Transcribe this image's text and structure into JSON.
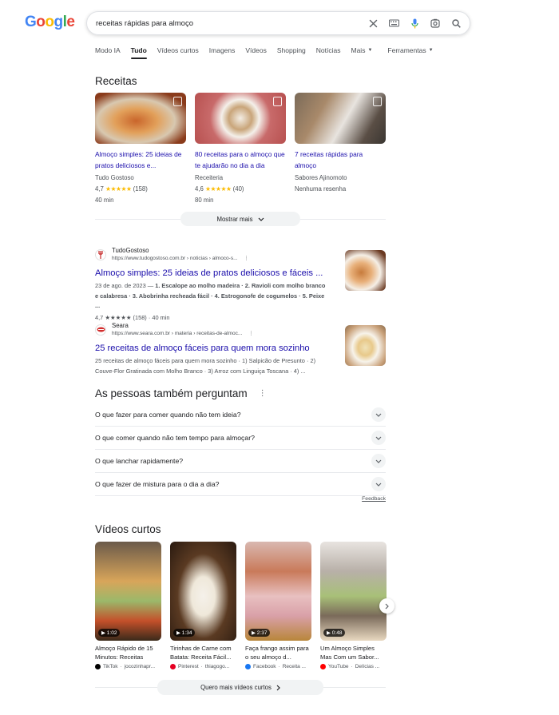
{
  "logo": {
    "letters": [
      "G",
      "o",
      "o",
      "g",
      "l",
      "e"
    ],
    "colors": [
      "#4285f4",
      "#ea4335",
      "#fbbc05",
      "#4285f4",
      "#34a853",
      "#ea4335"
    ]
  },
  "search": {
    "query": "receitas rápidas para almoço"
  },
  "tabs": [
    {
      "label": "Modo IA"
    },
    {
      "label": "Tudo"
    },
    {
      "label": "Vídeos curtos"
    },
    {
      "label": "Imagens"
    },
    {
      "label": "Vídeos"
    },
    {
      "label": "Shopping"
    },
    {
      "label": "Notícias"
    },
    {
      "label": "Mais"
    },
    {
      "label": "Ferramentas"
    }
  ],
  "recipes": {
    "title": "Receitas",
    "cards": [
      {
        "title": "Almoço simples: 25 ideias de pratos deliciosos e...",
        "source": "Tudo Gostoso",
        "rating": "4,7",
        "stars": "★★★★★",
        "reviews": "(158)",
        "time": "40 min"
      },
      {
        "title": "80 receitas para o almoço que te ajudarão no dia a dia",
        "source": "Receiteria",
        "rating": "4,6",
        "stars": "★★★★★",
        "reviews": "(40)",
        "time": "80 min"
      },
      {
        "title": "7 receitas rápidas para almoço",
        "source": "Sabores Ajinomoto",
        "rating_text": "Nenhuma resenha"
      }
    ],
    "show_more": "Mostrar mais"
  },
  "results": [
    {
      "site": "TudoGostoso",
      "url": "https://www.tudogostoso.com.br › noticias › almoco-s...",
      "title": "Almoço simples: 25 ideias de pratos deliciosos e fáceis ...",
      "snippet_date": "23 de ago. de 2023 — ",
      "snippet_main": "1. Escalope ao molho madeira · 2. Ravioli com molho branco e calabresa · 3. Abobrinha recheada fácil · 4. Estrogonofe de cogumelos · 5. Peixe ...",
      "rating_line": "4,7 ★★★★★ (158) · 40 min"
    },
    {
      "site": "Seara",
      "url": "https://www.seara.com.br › materia › receitas-de-almoc...",
      "title": "25 receitas de almoço fáceis para quem mora sozinho",
      "snippet_main": "25 receitas de almoço fáceis para quem mora sozinho · 1) Salpicão de Presunto · 2) Couve-Flor Gratinada com Molho Branco · 3) Arroz com Linguiça Toscana · 4) ..."
    }
  ],
  "paa": {
    "title": "As pessoas também perguntam",
    "questions": [
      "O que fazer para comer quando não tem ideia?",
      "O que comer quando não tem tempo para almoçar?",
      "O que lanchar rapidamente?",
      "O que fazer de mistura para o dia a dia?"
    ],
    "feedback": "Feedback"
  },
  "videos": {
    "title": "Vídeos curtos",
    "items": [
      {
        "title": "Almoço Rápido de 15 Minutos: Receitas Fáceis...",
        "duration": "▶ 1:02",
        "platform": "TikTok",
        "author": "jocozinhapr...",
        "color": "#000000"
      },
      {
        "title": "Tirinhas de Carne com Batata: Receita Fácil...",
        "duration": "▶ 1:34",
        "platform": "Pinterest",
        "author": "thiagogo...",
        "color": "#e60023"
      },
      {
        "title": "Faça frango assim para o seu almoço d...",
        "duration": "▶ 2:37",
        "platform": "Facebook",
        "author": "Receita ...",
        "color": "#1877f2"
      },
      {
        "title": "Um Almoço Simples Mas Com um Sabor...",
        "duration": "▶ 0:48",
        "platform": "YouTube",
        "author": "Delícias ...",
        "color": "#ff0000"
      }
    ],
    "more": "Quero mais vídeos curtos"
  }
}
